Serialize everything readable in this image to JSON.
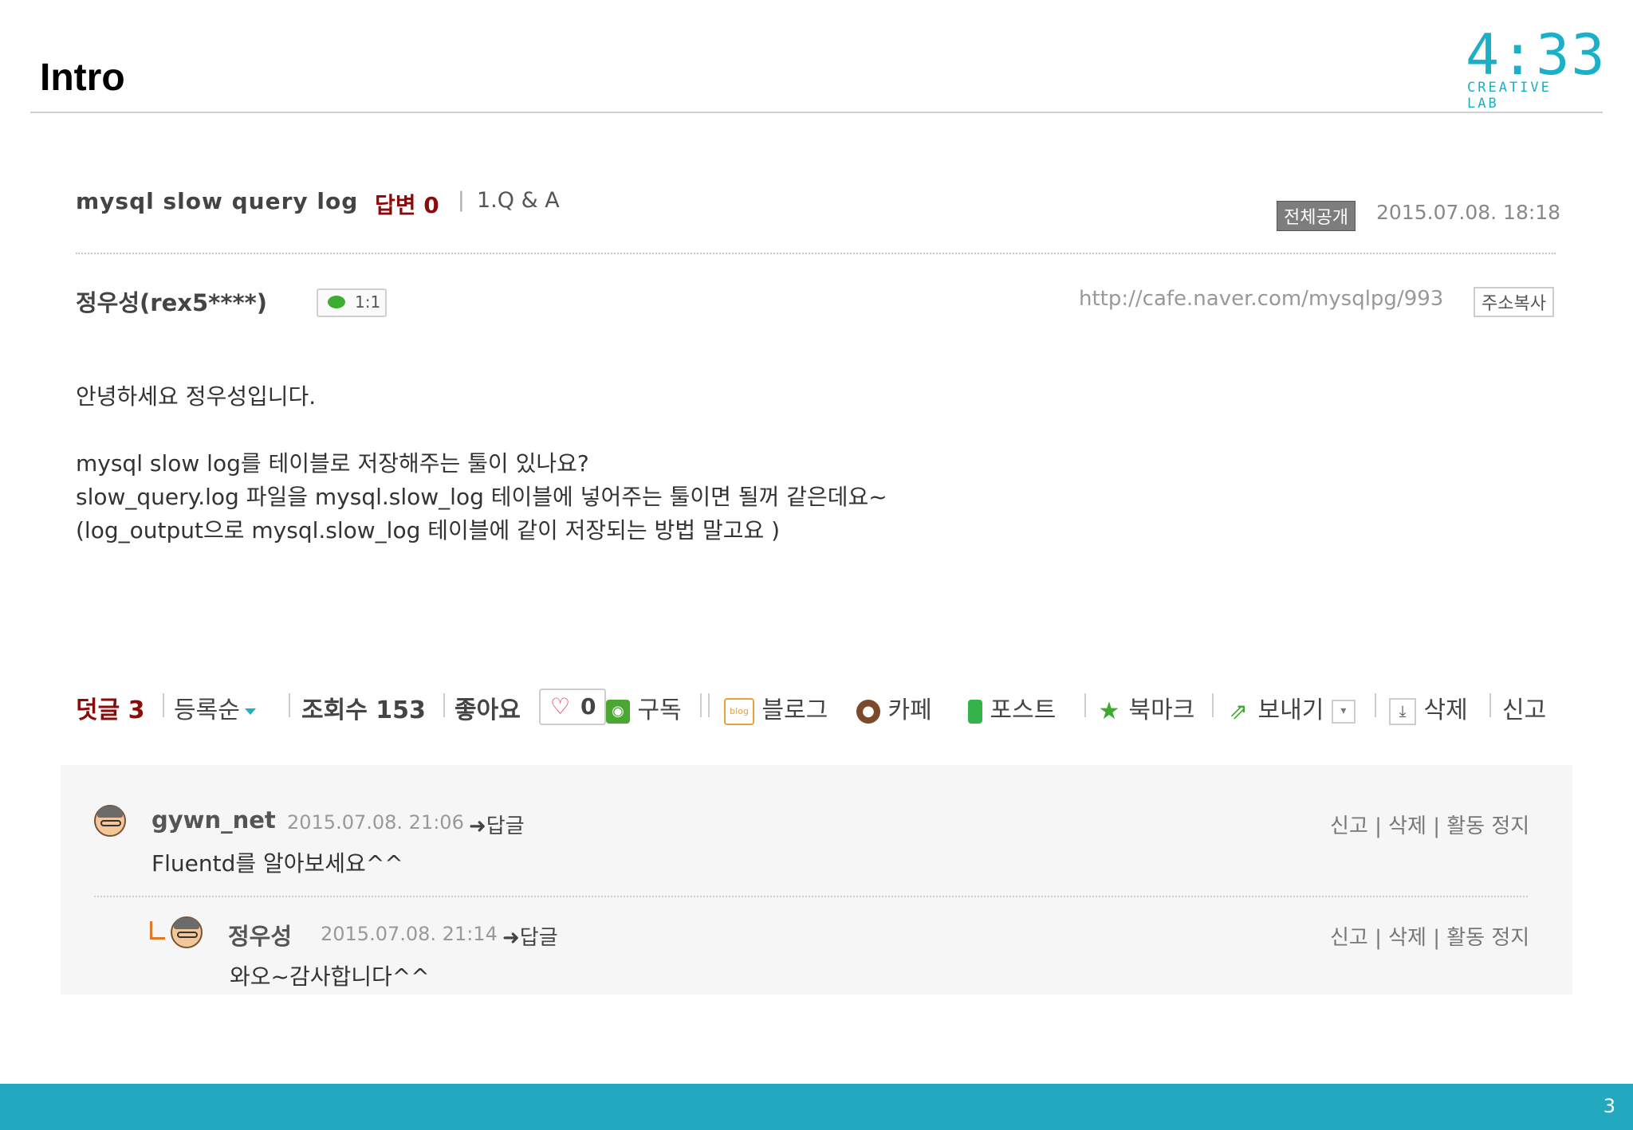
{
  "slide": {
    "title": "Intro",
    "page_number": "3"
  },
  "logo": {
    "time": "4:33",
    "sub": "CREATIVE LAB"
  },
  "post": {
    "title": "mysql slow query log",
    "reply_label": "답변 0",
    "separator": "|",
    "category": "1.Q & A",
    "visibility_badge": "전체공개",
    "date": "2015.07.08. 18:18",
    "author": "정우성(rex5****)",
    "chat_label": "1:1",
    "url": "http://cafe.naver.com/mysqlpg/993",
    "copy_url_label": "주소복사",
    "body": [
      "안녕하세요 정우성입니다.",
      "mysql slow log를 테이블로 저장해주는 툴이 있나요?",
      "slow_query.log 파일을 mysql.slow_log 테이블에 넣어주는 툴이면 될꺼 같은데요~",
      "(log_output으로 mysql.slow_log 테이블에 같이 저장되는 방법 말고요 )"
    ]
  },
  "actions": {
    "comments": "덧글 3",
    "sort": "등록순",
    "views": "조회수 153",
    "likes_label": "좋아요",
    "likes_count": "0",
    "subscribe": "구독",
    "blog": "블로그",
    "cafe": "카페",
    "post": "포스트",
    "bookmark": "북마크",
    "send": "보내기",
    "delete": "삭제",
    "report": "신고"
  },
  "comments": [
    {
      "user": "gywn_net",
      "date": "2015.07.08. 21:06",
      "reply": "답글",
      "actions": "신고 | 삭제 | 활동 정지",
      "text": "Fluentd를 알아보세요^^"
    },
    {
      "user": "정우성",
      "date": "2015.07.08. 21:14",
      "reply": "답글",
      "actions": "신고 | 삭제 | 활동 정지",
      "text": "와오~감사합니다^^"
    }
  ],
  "colors": {
    "accent": "#22a9bf",
    "reply_red": "#8b0a0a",
    "logo": "#1ab0c8"
  }
}
